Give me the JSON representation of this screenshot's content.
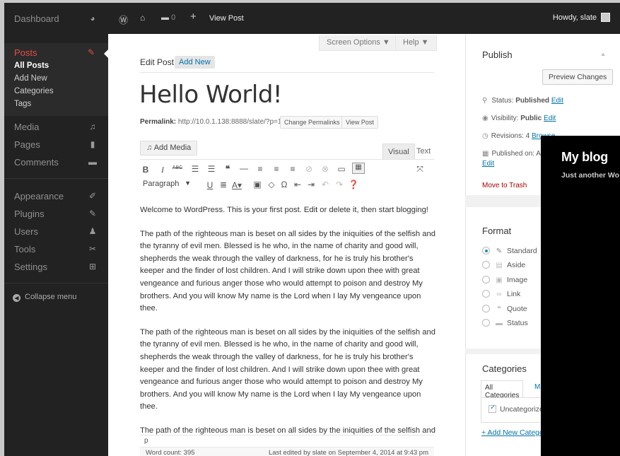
{
  "sidebar": {
    "dashboard": "Dashboard",
    "posts": {
      "title": "Posts",
      "sub": [
        "All Posts",
        "Add New",
        "Categories",
        "Tags"
      ]
    },
    "media": "Media",
    "pages": "Pages",
    "comments": "Comments",
    "appearance": "Appearance",
    "plugins": "Plugins",
    "users": "Users",
    "tools": "Tools",
    "settings": "Settings",
    "collapse": "Collapse menu"
  },
  "adminbar": {
    "comments_count": "0",
    "view_post": "View Post",
    "howdy": "Howdy, slate"
  },
  "main": {
    "screen_options": "Screen Options ▼",
    "help": "Help ▼",
    "edit_post": "Edit Post",
    "add_new": "Add New",
    "post_title": "Hello World!",
    "permalink_label": "Permalink:",
    "permalink_url": "http://10.0.1.138:8888/slate/?p=1",
    "change_permalinks": "Change Permalinks",
    "view_post": "View Post",
    "add_media": "Add Media",
    "tab_visual": "Visual",
    "tab_text": "Text",
    "paragraph": "Paragraph",
    "content": [
      "Welcome to WordPress. This is your first post. Edit or delete it, then start blogging!",
      "The path of the righteous man is beset on all sides by the iniquities of the selfish and the tyranny of evil men. Blessed is he who, in the name of charity and good will, shepherds the weak through the valley of darkness, for he is truly his brother's keeper and the finder of lost children. And I will strike down upon thee with great vengeance and furious anger those who would attempt to poison and destroy My brothers. And you will know My name is the Lord when I lay My vengeance upon thee.",
      "The path of the righteous man is beset on all sides by the iniquities of the selfish and the tyranny of evil men. Blessed is he who, in the name of charity and good will, shepherds the weak through the valley of darkness, for he is truly his brother's keeper and the finder of lost children. And I will strike down upon thee with great vengeance and furious anger those who would attempt to poison and destroy My brothers. And you will know My name is the Lord when I lay My vengeance upon thee.",
      "The path of the righteous man is beset on all sides by the iniquities of the selfish and the tyranny of evil men. Blessed is he who, in the name of charity and good will, shepherds the weak through the valley of darkness, for he is truly his brother's"
    ],
    "path": "p",
    "word_count": "Word count: 395",
    "last_edited": "Last edited by slate on September 4, 2014 at 9:43 pm"
  },
  "publish": {
    "title": "Publish",
    "preview": "Preview Changes",
    "status_label": "Status:",
    "status_value": "Published",
    "edit": "Edit",
    "visibility_label": "Visibility:",
    "visibility_value": "Public",
    "revisions": "Revisions: 4",
    "browse": "Browse",
    "published_on": "Published on: A",
    "move_to_trash": "Move to Trash"
  },
  "format": {
    "title": "Format",
    "options": [
      "Standard",
      "Aside",
      "Image",
      "Link",
      "Quote",
      "Status"
    ],
    "selected": "Standard"
  },
  "categories": {
    "title": "Categories",
    "tab_all": "All Categories",
    "tab_most": "M",
    "item": "Uncategorize",
    "add_new": "+ Add New Catego"
  },
  "preview_overlay": {
    "site_title": "My blog",
    "tagline": "Just another Wo"
  },
  "colors": {
    "menu_bg": "#222222",
    "accent": "#e14d43",
    "link": "#0073aa"
  }
}
